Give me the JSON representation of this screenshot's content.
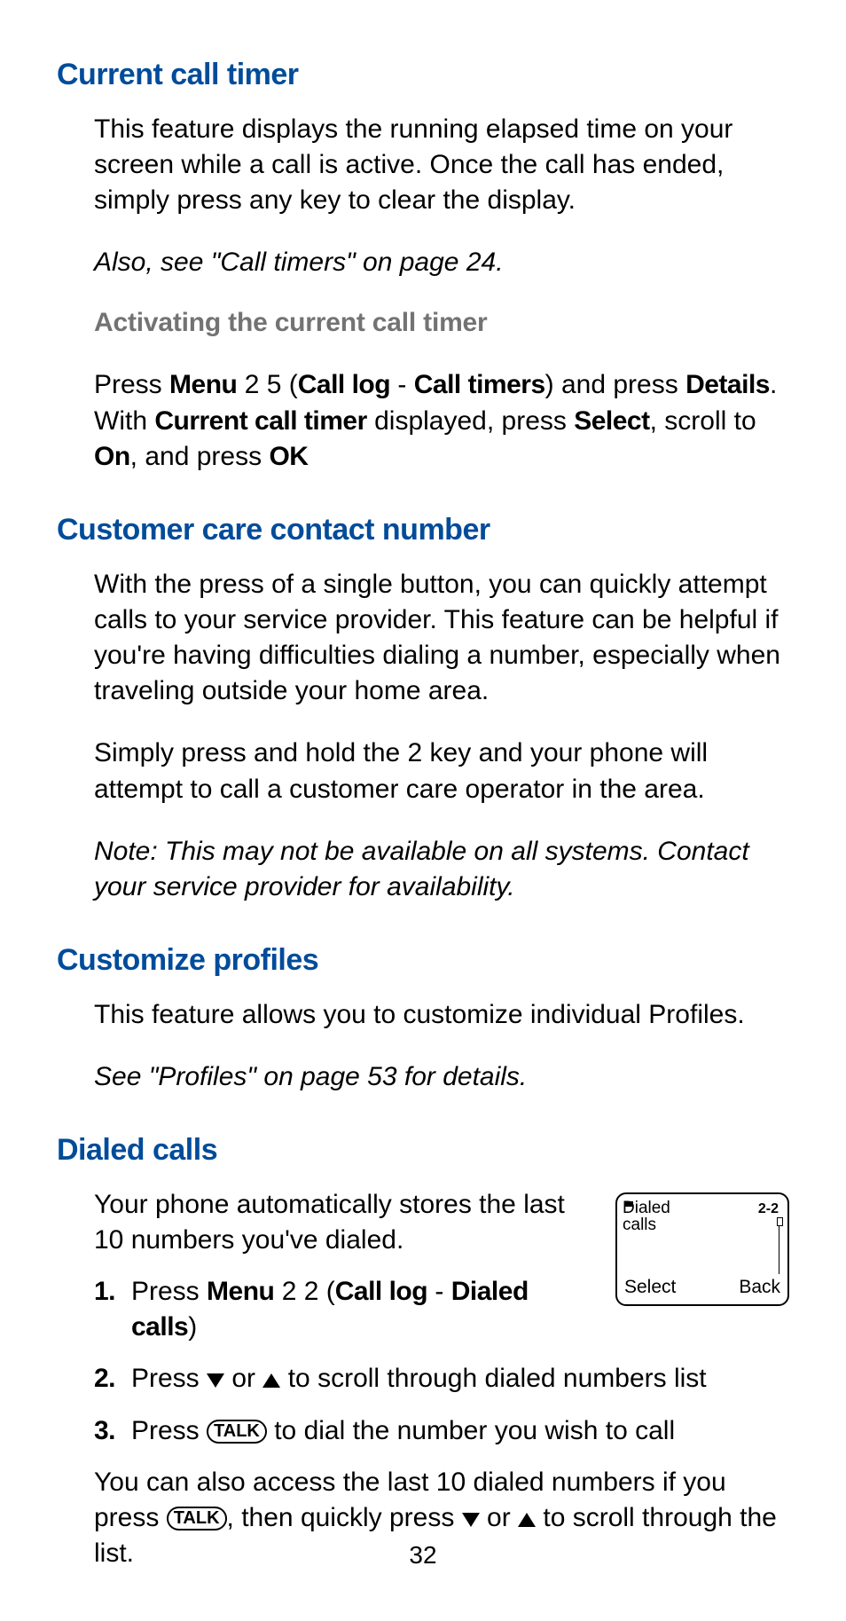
{
  "pageNumber": "32",
  "sections": {
    "currentCallTimer": {
      "heading": "Current call timer",
      "body": "This feature displays the running elapsed time on your screen while a call is active. Once the call has ended, simply press any key to clear the display.",
      "crossRef": "Also, see \"Call timers\" on page 24.",
      "sub": {
        "heading": "Activating the current call timer",
        "press": "Press ",
        "menu": "Menu",
        "menuSeq": " 2 5 (",
        "callLog": "Call log",
        "dash": " - ",
        "callTimers": "Call timers",
        "closeAnd": ") and press ",
        "details": "Details",
        "afterDetails": ". With ",
        "cct": "Current call timer",
        "afterCct": " displayed, press ",
        "select": "Select",
        "scrollTo": ", scroll to ",
        "on": "On",
        "andPress": ", and press ",
        "ok": "OK"
      }
    },
    "customerCare": {
      "heading": "Customer care contact number",
      "p1": "With the press of a single button, you can quickly attempt calls to your service provider. This feature can be helpful if you're having difficulties dialing a number, especially when traveling outside your home area.",
      "p2": "Simply press and hold the 2 key and your phone will attempt to call a customer care operator in the area.",
      "note": "Note: This may not be available on all systems. Contact your service provider for availability."
    },
    "customizeProfiles": {
      "heading": "Customize profiles",
      "body": "This feature allows you to customize individual Profiles.",
      "crossRef": " See \"Profiles\" on page 53 for details."
    },
    "dialedCalls": {
      "heading": "Dialed calls",
      "intro": "Your phone automatically stores the last 10 numbers you've dialed.",
      "step1": {
        "num": "1.",
        "press": "Press ",
        "menu": "Menu",
        "seq": " 2 2 (",
        "callLog": "Call log",
        "dash": " - ",
        "dialed": "Dialed calls",
        "close": ")"
      },
      "step2": {
        "num": "2.",
        "pressPre": "Press ",
        "or": " or ",
        "after": " to scroll through dialed numbers list"
      },
      "step3": {
        "num": "3.",
        "pressPre": "Press ",
        "talk": "TALK",
        "after": " to dial the number you wish to call"
      },
      "closing": {
        "pre": "You can also access the last 10 dialed numbers if you press ",
        "talk": "TALK",
        "mid": ", then quickly press ",
        "or": " or ",
        "after": " to scroll through the list."
      },
      "screen": {
        "title1": "Dialed",
        "title2": "calls",
        "indicator": "2-2",
        "softLeft": "Select",
        "softRight": "Back"
      }
    }
  }
}
